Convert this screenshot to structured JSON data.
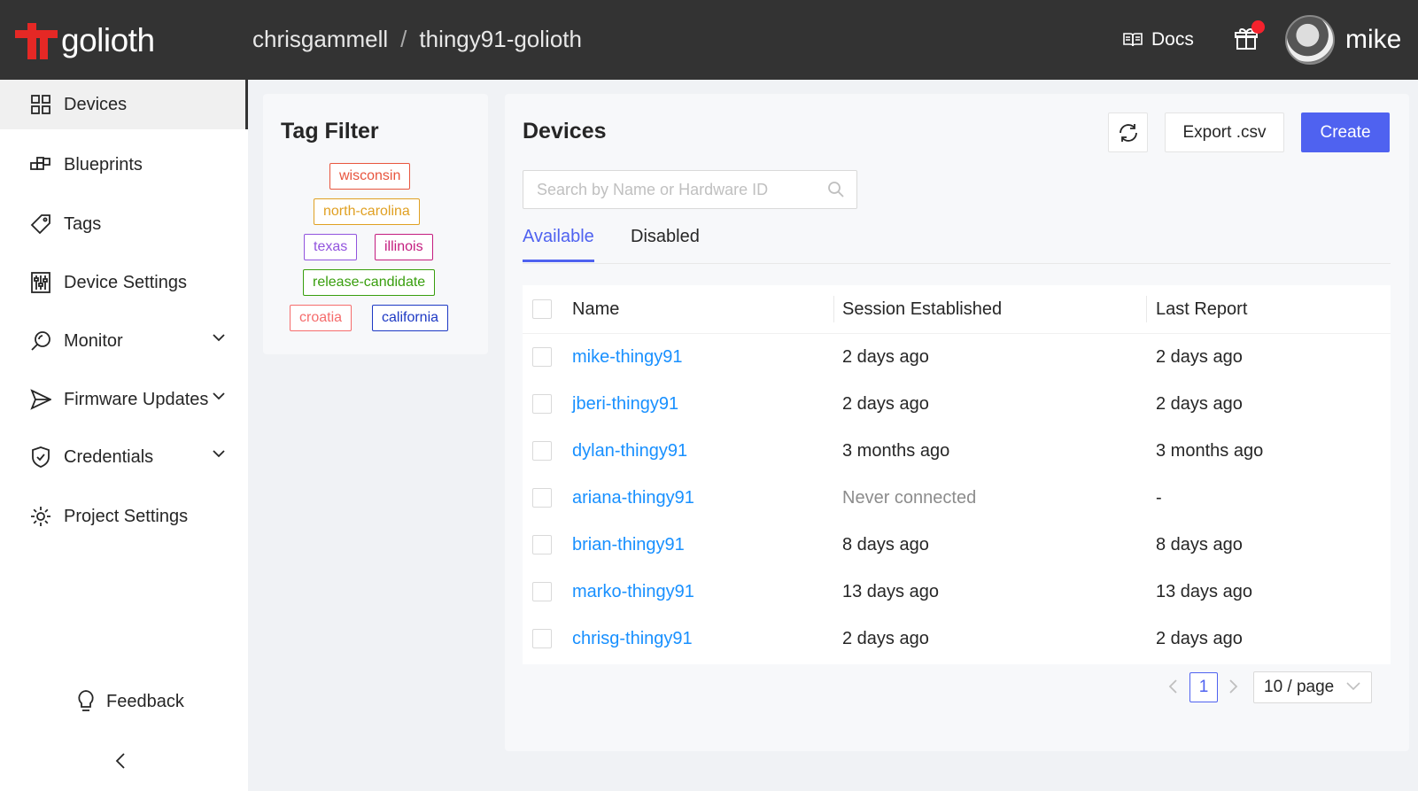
{
  "brand": {
    "name": "golioth",
    "accent": "#e52825"
  },
  "breadcrumb": {
    "org": "chrisgammell",
    "separator": "/",
    "project": "thingy91-golioth"
  },
  "header": {
    "docs_label": "Docs",
    "username": "mike",
    "gift_icon": "gift-icon",
    "notification_color": "#f5222d"
  },
  "sidebar": {
    "items": [
      {
        "label": "Devices",
        "icon": "grid-icon"
      },
      {
        "label": "Blueprints",
        "icon": "blueprint-icon"
      },
      {
        "label": "Tags",
        "icon": "tag-icon"
      },
      {
        "label": "Device Settings",
        "icon": "sliders-icon"
      },
      {
        "label": "Monitor",
        "icon": "monitor-icon"
      },
      {
        "label": "Firmware Updates",
        "icon": "send-icon"
      },
      {
        "label": "Credentials",
        "icon": "shield-icon"
      },
      {
        "label": "Project Settings",
        "icon": "gear-icon"
      }
    ],
    "feedback_label": "Feedback"
  },
  "tag_filter": {
    "title": "Tag Filter",
    "tags": [
      {
        "label": "wisconsin",
        "color": "#e8553e"
      },
      {
        "label": "north-carolina",
        "color": "#e0a022"
      },
      {
        "label": "texas",
        "color": "#9254de"
      },
      {
        "label": "illinois",
        "color": "#c41d7f"
      },
      {
        "label": "release-candidate",
        "color": "#389e0d"
      },
      {
        "label": "croatia",
        "color": "#f56c6c"
      },
      {
        "label": "california",
        "color": "#1d39c4"
      }
    ]
  },
  "devices": {
    "title": "Devices",
    "export_label": "Export .csv",
    "create_label": "Create",
    "search_placeholder": "Search by Name or Hardware ID",
    "tabs": [
      {
        "label": "Available"
      },
      {
        "label": "Disabled"
      }
    ],
    "columns": {
      "name": "Name",
      "session": "Session Established",
      "report": "Last Report"
    },
    "rows": [
      {
        "name": "mike-thingy91",
        "session": "2 days ago",
        "report": "2 days ago"
      },
      {
        "name": "jberi-thingy91",
        "session": "2 days ago",
        "report": "2 days ago"
      },
      {
        "name": "dylan-thingy91",
        "session": "3 months ago",
        "report": "3 months ago"
      },
      {
        "name": "ariana-thingy91",
        "session": "Never connected",
        "report": "-"
      },
      {
        "name": "brian-thingy91",
        "session": "8 days ago",
        "report": "8 days ago"
      },
      {
        "name": "marko-thingy91",
        "session": "13 days ago",
        "report": "13 days ago"
      },
      {
        "name": "chrisg-thingy91",
        "session": "2 days ago",
        "report": "2 days ago"
      }
    ],
    "pagination": {
      "current_page": "1",
      "page_size": "10 / page"
    }
  }
}
